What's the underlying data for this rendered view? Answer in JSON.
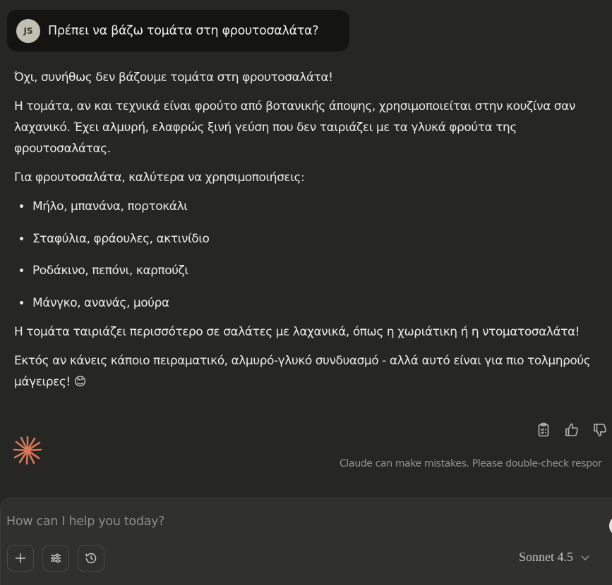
{
  "user_message": {
    "avatar_initials": "JS",
    "text": "Πρέπει να βάζω τομάτα στη φρουτοσαλάτα?"
  },
  "response": {
    "p1": "Όχι, συνήθως δεν βάζουμε τομάτα στη φρουτοσαλάτα!",
    "p2": "Η τομάτα, αν και τεχνικά είναι φρούτο από βοτανικής άποψης, χρησιμοποιείται στην κουζίνα σαν λαχανικό. Έχει αλμυρή, ελαφρώς ξινή γεύση που δεν ταιριάζει με τα γλυκά φρούτα της φρουτοσαλάτας.",
    "p3": "Για φρουτοσαλάτα, καλύτερα να χρησιμοποιήσεις:",
    "list": [
      "Μήλο, μπανάνα, πορτοκάλι",
      "Σταφύλια, φράουλες, ακτινίδιο",
      "Ροδάκινο, πεπόνι, καρπούζι",
      "Μάνγκο, ανανάς, μούρα"
    ],
    "p4": "Η τομάτα ταιριάζει περισσότερο σε σαλάτες με λαχανικά, όπως η χωριάτικη ή η ντοματοσαλάτα!",
    "p5": "Εκτός αν κάνεις κάποιο πειραματικό, αλμυρό-γλυκό συνδυασμό - αλλά αυτό είναι για πιο τολμηρούς μάγειρες! 😊"
  },
  "actions": {
    "icons": [
      "copy-icon",
      "thumbs-up-icon",
      "thumbs-down-icon"
    ]
  },
  "disclaimer": "Claude can make mistakes. Please double-check respor",
  "composer": {
    "placeholder": "How can I help you today?",
    "model": "Sonnet 4.5"
  },
  "colors": {
    "background": "#262624",
    "user_bubble": "#141413",
    "composer": "#30302e",
    "claude_accent": "#d97757"
  }
}
